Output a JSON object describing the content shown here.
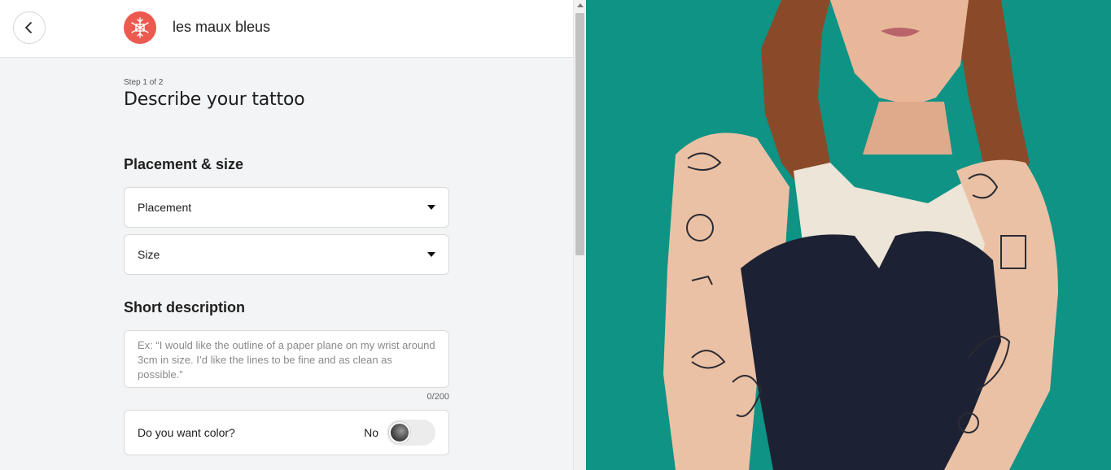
{
  "header": {
    "back_icon": "chevron-left-icon",
    "logo_icon": "snowflake-logo-icon",
    "brand_name": "les maux bleus",
    "logo_color": "#ec5a4f"
  },
  "form": {
    "step": "Step 1 of 2",
    "title": "Describe your tattoo",
    "placement_section": {
      "title": "Placement & size",
      "placement_label": "Placement",
      "size_label": "Size"
    },
    "description_section": {
      "title": "Short description",
      "placeholder": "Ex: “I would like the outline of a paper plane on my wrist around 3cm in size. I’d like the lines to be fine and as clean as possible.”",
      "value": "",
      "counter": "0/200"
    },
    "color_question": {
      "label": "Do you want color?",
      "state_text": "No"
    }
  },
  "photo": {
    "background_color": "#0e9385"
  }
}
